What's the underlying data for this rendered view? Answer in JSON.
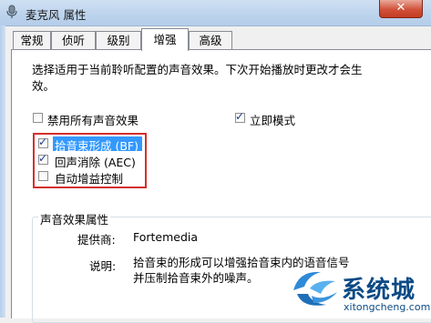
{
  "window": {
    "title": "麦克风 属性",
    "close_glyph": "✕"
  },
  "tabs": [
    {
      "label": "常规",
      "active": false
    },
    {
      "label": "侦听",
      "active": false
    },
    {
      "label": "级别",
      "active": false
    },
    {
      "label": "增强",
      "active": true
    },
    {
      "label": "高级",
      "active": false
    }
  ],
  "description_lines": [
    "选择适用于当前聆听配置的声音效果。下次开始播放时更改才会生",
    "效。"
  ],
  "options": {
    "disable_all": {
      "label": "禁用所有声音效果",
      "checked": false
    },
    "immediate_mode": {
      "label": "立即模式",
      "checked": true
    }
  },
  "effects": [
    {
      "label": "拾音束形成 (BF)",
      "checked": true,
      "selected": true
    },
    {
      "label": "回声消除 (AEC)",
      "checked": true,
      "selected": false
    },
    {
      "label": "自动增益控制",
      "checked": false,
      "selected": false
    }
  ],
  "properties": {
    "group_title": "声音效果属性",
    "provider_label": "提供商:",
    "provider_value": "Fortemedia",
    "description_label": "说明:",
    "description_lines": [
      "拾音束的形成可以增强拾音束内的语音信号",
      "并压制拾音束外的噪声。"
    ]
  },
  "watermark": {
    "text": "系统城",
    "url": "xitongcheng.com"
  },
  "colors": {
    "selection": "#3399ff",
    "highlight_box": "#d3302a",
    "watermark": "#0c4a85"
  }
}
